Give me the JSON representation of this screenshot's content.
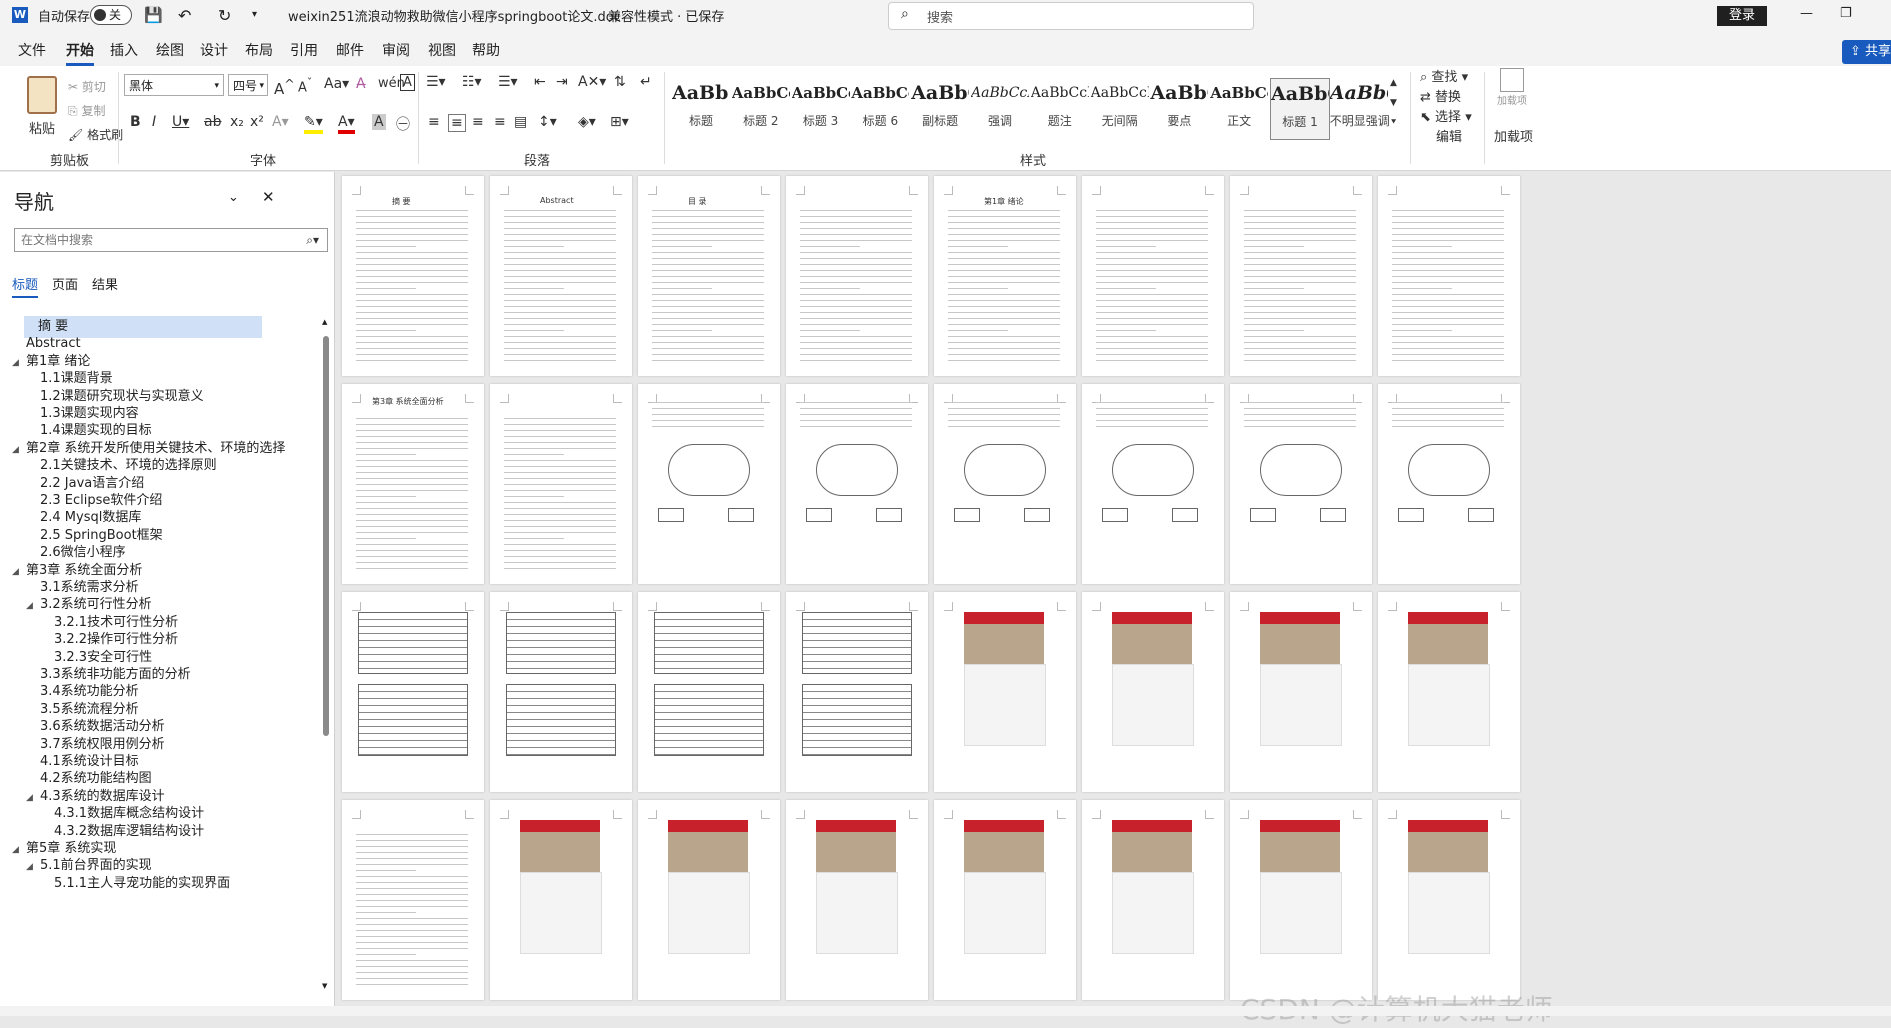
{
  "titlebar": {
    "autosave_label": "自动保存",
    "autosave_state": "关",
    "doc_name": "weixin251流浪动物救助微信小程序springboot论文.doc",
    "mode": "兼容性模式 · 已保存",
    "search_placeholder": "搜索",
    "login": "登录"
  },
  "menu": {
    "tabs": [
      "文件",
      "开始",
      "插入",
      "绘图",
      "设计",
      "布局",
      "引用",
      "邮件",
      "审阅",
      "视图",
      "帮助"
    ],
    "share": "共享"
  },
  "ribbon": {
    "clipboard": {
      "paste": "粘贴",
      "cut": "剪切",
      "copy": "复制",
      "format_painter": "格式刷",
      "label": "剪贴板"
    },
    "font": {
      "name": "黑体",
      "size": "四号",
      "label": "字体"
    },
    "paragraph_label": "段落",
    "styles": {
      "label": "样式",
      "items": [
        {
          "sample": "AaBb(",
          "name": "标题"
        },
        {
          "sample": "AaBbCc",
          "name": "标题 2"
        },
        {
          "sample": "AaBbCcI",
          "name": "标题 3"
        },
        {
          "sample": "AaBbCcI",
          "name": "标题 6"
        },
        {
          "sample": "AaBbC",
          "name": "副标题"
        },
        {
          "sample": "AaBbCcL",
          "name": "强调"
        },
        {
          "sample": "AaBbCcD",
          "name": "题注"
        },
        {
          "sample": "AaBbCcD",
          "name": "无间隔"
        },
        {
          "sample": "AaBbCcl",
          "name": "要点"
        },
        {
          "sample": "AaBbCcI",
          "name": "正文"
        },
        {
          "sample": "AaBbC(",
          "name": "标题 1"
        },
        {
          "sample": "AaBbCcL",
          "name": "不明显强调"
        }
      ]
    },
    "editing": {
      "find": "查找",
      "replace": "替换",
      "select": "选择",
      "label": "编辑"
    },
    "addins": {
      "button": "加载项",
      "label": "加载项"
    }
  },
  "nav": {
    "title": "导航",
    "search_placeholder": "在文档中搜索",
    "tabs": [
      "标题",
      "页面",
      "结果"
    ],
    "items": [
      {
        "label": "摘  要",
        "level": 0,
        "selected": true
      },
      {
        "label": "Abstract",
        "level": 0
      },
      {
        "label": "第1章 绪论",
        "level": 0,
        "expand": true
      },
      {
        "label": "1.1课题背景",
        "level": 1
      },
      {
        "label": "1.2课题研究现状与实现意义",
        "level": 1
      },
      {
        "label": "1.3课题实现内容",
        "level": 1
      },
      {
        "label": "1.4课题实现的目标",
        "level": 1
      },
      {
        "label": "第2章 系统开发所使用关键技术、环境的选择",
        "level": 0,
        "expand": true
      },
      {
        "label": "2.1关键技术、环境的选择原则",
        "level": 1
      },
      {
        "label": "2.2 Java语言介绍",
        "level": 1
      },
      {
        "label": "2.3 Eclipse软件介绍",
        "level": 1
      },
      {
        "label": "2.4 Mysql数据库",
        "level": 1
      },
      {
        "label": "2.5 SpringBoot框架",
        "level": 1
      },
      {
        "label": "2.6微信小程序",
        "level": 1
      },
      {
        "label": "第3章 系统全面分析",
        "level": 0,
        "expand": true
      },
      {
        "label": "3.1系统需求分析",
        "level": 1
      },
      {
        "label": "3.2系统可行性分析",
        "level": 1,
        "expand": true
      },
      {
        "label": "3.2.1技术可行性分析",
        "level": 2
      },
      {
        "label": "3.2.2操作可行性分析",
        "level": 2
      },
      {
        "label": "3.2.3安全可行性",
        "level": 2
      },
      {
        "label": "3.3系统非功能方面的分析",
        "level": 1
      },
      {
        "label": "3.4系统功能分析",
        "level": 1
      },
      {
        "label": "3.5系统流程分析",
        "level": 1
      },
      {
        "label": "3.6系统数据活动分析",
        "level": 1
      },
      {
        "label": "3.7系统权限用例分析",
        "level": 1
      },
      {
        "label": "4.1系统设计目标",
        "level": 1
      },
      {
        "label": "4.2系统功能结构图",
        "level": 1
      },
      {
        "label": "4.3系统的数据库设计",
        "level": 1,
        "expand": true
      },
      {
        "label": "4.3.1数据库概念结构设计",
        "level": 2
      },
      {
        "label": "4.3.2数据库逻辑结构设计",
        "level": 2
      },
      {
        "label": "第5章 系统实现",
        "level": 0,
        "expand": true
      },
      {
        "label": "5.1前台界面的实现",
        "level": 1,
        "expand": true
      },
      {
        "label": "5.1.1主人寻宠功能的实现界面",
        "level": 2
      }
    ]
  },
  "pages": {
    "page_titles": [
      "摘  要",
      "Abstract",
      "目  录",
      "",
      "第1章 绪论",
      "",
      "",
      "",
      "第3章 系统全面分析"
    ],
    "watermark": "CSDN @计算机大猫老师"
  },
  "colors": {
    "accent": "#185abd",
    "selected_nav": "#cfe0f7",
    "app_red": "#c7222b"
  }
}
